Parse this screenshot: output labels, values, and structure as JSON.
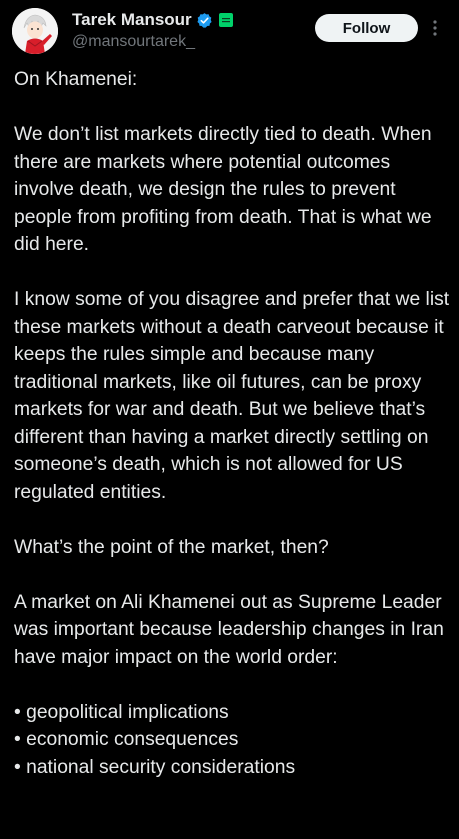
{
  "author": {
    "display_name": "Tarek Mansour",
    "handle": "@mansourtarek_"
  },
  "icons": {
    "verified": "verified-badge-icon",
    "affiliate": "affiliate-badge-icon",
    "more": "more-options-icon",
    "avatar": "avatar-image"
  },
  "colors": {
    "background": "#000000",
    "text": "#e7e9ea",
    "secondary_text": "#71767b",
    "verified_blue": "#1d9bf0",
    "affiliate_green": "#00d26a",
    "follow_button_bg": "#eff3f4"
  },
  "actions": {
    "follow_label": "Follow"
  },
  "tweet": {
    "paragraphs": [
      "On Khamenei:",
      "We don’t list markets directly tied to death. When there are markets where potential outcomes involve death, we design the rules to prevent people from profiting from death. That is what we did here.",
      "I know some of you disagree and prefer that we list these markets without a death carveout because it keeps the rules simple and because many traditional markets, like oil futures, can be proxy markets for war and death. But we believe that’s different than having a market directly settling on someone’s death, which is not allowed for US regulated entities.",
      "What’s the point of the market, then?",
      "A market on Ali Khamenei out as Supreme Leader was important because leadership changes in Iran have major impact on the world order:"
    ],
    "bullets": [
      "• geopolitical implications",
      "• economic consequences",
      "• national security considerations"
    ]
  }
}
